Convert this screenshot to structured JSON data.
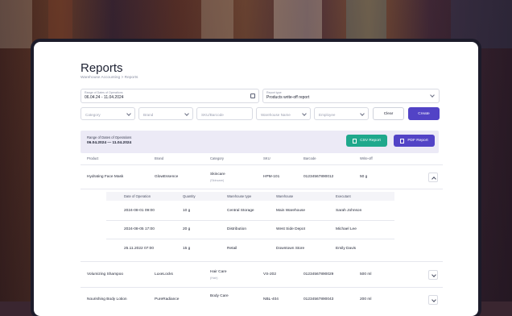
{
  "page": {
    "title": "Reports",
    "breadcrumb": "Warehouse Accounting  >  Reports"
  },
  "filters": {
    "date_range_label": "Range of Dates of Operations",
    "date_range_value": "06.04.24 - 11.04.2024",
    "report_type_label": "Report type",
    "report_type_value": "Products write-off report",
    "category_ph": "Category",
    "brand_ph": "Brand",
    "sku_ph": "SKU/Barcode",
    "warehouse_ph": "Warehouse Name",
    "employee_ph": "Employee",
    "clear_label": "Clear",
    "create_label": "Create"
  },
  "banner": {
    "label": "Range of Dates of Operations",
    "value": "06.04.2024 — 11.04.2024",
    "csv_label": "CSV Report",
    "pdf_label": "PDF Report"
  },
  "table": {
    "headers": [
      "Product",
      "Brand",
      "Category",
      "SKU",
      "Barcode",
      "Write-off"
    ],
    "rows": [
      {
        "product": "Hydrating Face Mask",
        "brand": "GlowEssence",
        "category": "Skincare",
        "subcategory": "(Skincare)",
        "sku": "HPM-101",
        "barcode": "01234567890012",
        "writeoff": "50 g"
      },
      {
        "product": "Volumizing Shampoo",
        "brand": "LuxeLocks",
        "category": "Hair Care",
        "subcategory": "(Hair)",
        "sku": "VS-202",
        "barcode": "01234567890029",
        "writeoff": "500 ml"
      },
      {
        "product": "Nourishing Body Lotion",
        "brand": "PureRadiance",
        "category": "Body Care",
        "subcategory": "",
        "sku": "NBL-404",
        "barcode": "01234567890043",
        "writeoff": "200 ml"
      }
    ]
  },
  "detail": {
    "headers": [
      "Date of Operation",
      "Quantity",
      "Warehouse type",
      "Warehouse",
      "Executant"
    ],
    "rows": [
      {
        "date": "2024-08-01 09:00",
        "qty": "10 g",
        "type": "Central Storage",
        "warehouse": "Main Warehouse",
        "executant": "Sarah Johnson"
      },
      {
        "date": "2024-08-05 17:00",
        "qty": "20 g",
        "type": "Distribution",
        "warehouse": "West Side Depot",
        "executant": "Michael Lee"
      },
      {
        "date": "25.11.2022 07:00",
        "qty": "15 g",
        "type": "Retail",
        "warehouse": "Downtown Store",
        "executant": "Emily Davis"
      }
    ]
  },
  "colors": {
    "accent": "#5243c6",
    "csv": "#1fa88c",
    "banner_bg": "#eceaf6"
  }
}
